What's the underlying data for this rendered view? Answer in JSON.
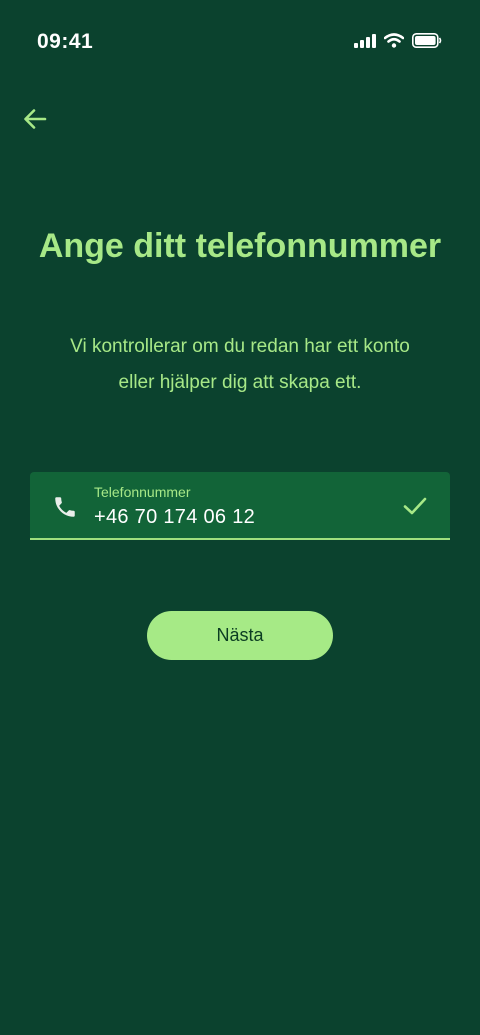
{
  "status_bar": {
    "time": "09:41",
    "icons": [
      "signal-icon",
      "wifi-icon",
      "battery-icon"
    ]
  },
  "header": {
    "back_icon": "arrow-left-icon"
  },
  "main": {
    "title": "Ange ditt telefonnummer",
    "subtitle": "Vi kontrollerar om du redan har ett konto eller hjälper dig att skapa ett.",
    "phone_field": {
      "label": "Telefonnummer",
      "value": "+46 70 174 06 12",
      "leading_icon": "phone-icon",
      "trailing_icon": "check-icon",
      "valid": true
    },
    "next_button_label": "Nästa"
  },
  "colors": {
    "background": "#0b422e",
    "accent": "#a7e887",
    "field_background": "#126438",
    "text_on_accent": "#0b3d22"
  }
}
